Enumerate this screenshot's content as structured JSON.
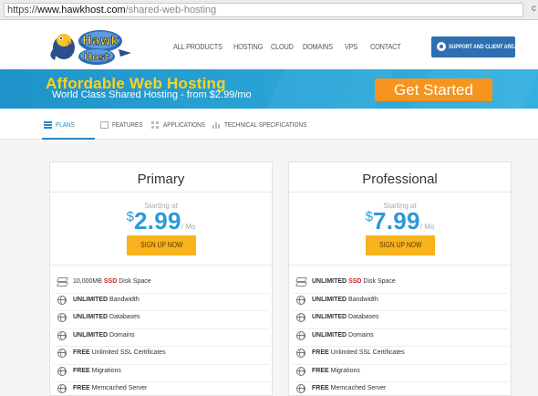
{
  "browser": {
    "url_proto": "https://",
    "url_host": "www.hawkhost.com",
    "url_path": "/shared-web-hosting"
  },
  "header": {
    "logo_alt": "Hawk Host",
    "nav": [
      "ALL PRODUCTS",
      "HOSTING",
      "CLOUD",
      "DOMAINS",
      "VPS",
      "CONTACT"
    ],
    "support_label": "SUPPORT AND CLIENT AREA"
  },
  "banner": {
    "title": "Affordable Web Hosting",
    "subtitle": "World Class Shared Hosting - from $2.99/mo",
    "cta_label": "Get Started"
  },
  "tabs": [
    {
      "label": "PLANS",
      "icon": "list-icon",
      "active": true
    },
    {
      "label": "FEATURES",
      "icon": "document-icon",
      "active": false
    },
    {
      "label": "APPLICATIONS",
      "icon": "grid-icon",
      "active": false
    },
    {
      "label": "TECHNICAL SPECIFICATIONS",
      "icon": "bar-chart-icon",
      "active": false
    }
  ],
  "plans": [
    {
      "name": "Primary",
      "starting_label": "Starting at",
      "currency": "$",
      "price": "2.99",
      "per": "/ Mo",
      "signup_label": "SIGN UP NOW",
      "features": [
        {
          "pre": "10,000MB ",
          "hl": "SSD",
          "post": " Disk Space",
          "bold": false
        },
        {
          "pre": "UNLIMITED",
          "post": " Bandwidth",
          "bold": true
        },
        {
          "pre": "UNLIMITED",
          "post": " Databases",
          "bold": true
        },
        {
          "pre": "UNLIMITED",
          "post": " Domains",
          "bold": true
        },
        {
          "pre": "FREE",
          "post": " Unlimited SSL Certificates",
          "bold": true
        },
        {
          "pre": "FREE",
          "post": " Migrations",
          "bold": true
        },
        {
          "pre": "FREE",
          "post": " Memcached Server",
          "bold": true
        }
      ]
    },
    {
      "name": "Professional",
      "starting_label": "Starting at",
      "currency": "$",
      "price": "7.99",
      "per": "/ Mo",
      "signup_label": "SIGN UP NOW",
      "features": [
        {
          "pre": "UNLIMITED",
          "hl": "SSD",
          "post": " Disk Space",
          "bold": true
        },
        {
          "pre": "UNLIMITED",
          "post": " Bandwidth",
          "bold": true
        },
        {
          "pre": "UNLIMITED",
          "post": " Databases",
          "bold": true
        },
        {
          "pre": "UNLIMITED",
          "post": " Domains",
          "bold": true
        },
        {
          "pre": "FREE",
          "post": " Unlimited SSL Certificates",
          "bold": true
        },
        {
          "pre": "FREE",
          "post": " Migrations",
          "bold": true
        },
        {
          "pre": "FREE",
          "post": " Memcached Server",
          "bold": true
        }
      ]
    }
  ],
  "colors": {
    "accent_blue": "#2b86c5",
    "price_blue": "#2b9ad6",
    "banner_blue": "#2aa6d8",
    "banner_title_yellow": "#ffd21f",
    "cta_orange": "#f7941d",
    "signup_yellow": "#f7b21c",
    "ssd_red": "#d0201d"
  }
}
